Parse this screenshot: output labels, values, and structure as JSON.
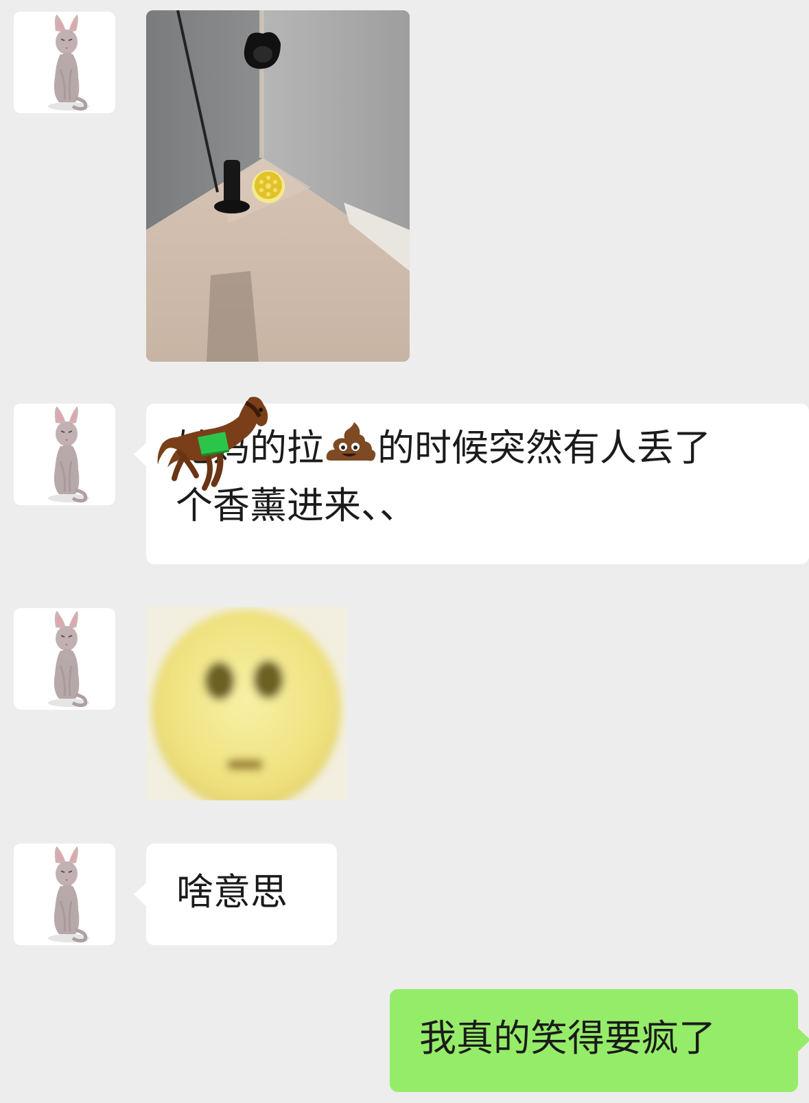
{
  "messages": [
    {
      "from": "other",
      "type": "image",
      "icon": "photo-bathroom-corner"
    },
    {
      "from": "other",
      "type": "text",
      "line1": "她妈的拉",
      "emoji": "poop-emoji",
      "line1_rest": "的时候突然有人丢了",
      "line2": "个香薰进来、、",
      "overlay": "horse-emoji"
    },
    {
      "from": "other",
      "type": "sticker",
      "icon": "flushed-face-sticker"
    },
    {
      "from": "other",
      "type": "text",
      "text": "啥意思"
    },
    {
      "from": "me",
      "type": "text",
      "text": "我真的笑得要疯了"
    }
  ],
  "colors": {
    "background": "#ededed",
    "incoming_bubble": "#ffffff",
    "outgoing_bubble": "#95ec69"
  }
}
